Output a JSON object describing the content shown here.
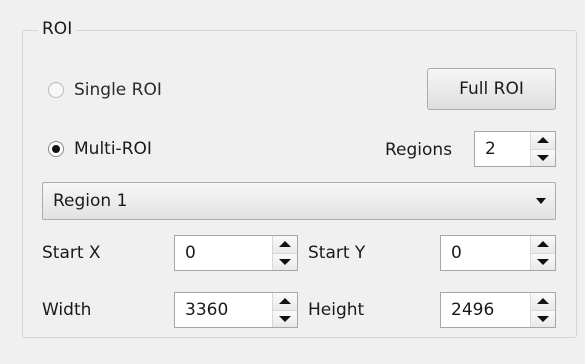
{
  "roi_group": {
    "title": "ROI",
    "single_roi": {
      "label": "Single ROI",
      "checked": false
    },
    "full_roi_button": "Full ROI",
    "multi_roi": {
      "label": "Multi-ROI",
      "checked": true
    },
    "regions": {
      "label": "Regions",
      "value": "2"
    },
    "region_select": {
      "selected": "Region 1"
    },
    "start_x": {
      "label": "Start X",
      "value": "0"
    },
    "start_y": {
      "label": "Start Y",
      "value": "0"
    },
    "width": {
      "label": "Width",
      "value": "3360"
    },
    "height": {
      "label": "Height",
      "value": "2496"
    }
  }
}
